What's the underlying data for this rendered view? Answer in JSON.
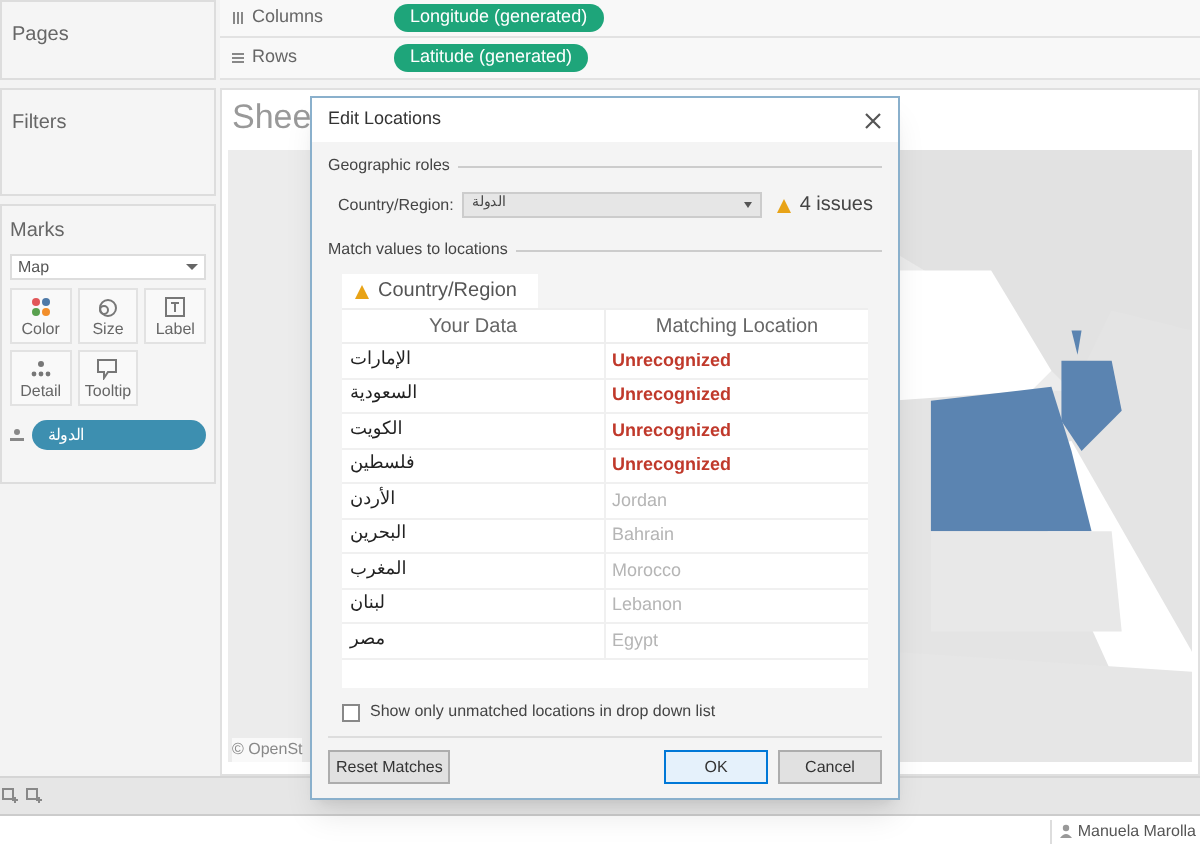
{
  "pages_label": "Pages",
  "columns_shelf": {
    "label": "Columns",
    "pill": "Longitude (generated)"
  },
  "rows_shelf": {
    "label": "Rows",
    "pill": "Latitude (generated)"
  },
  "filters_label": "Filters",
  "marks": {
    "label": "Marks",
    "type": "Map",
    "buttons": [
      {
        "label": "Color",
        "kind": "color"
      },
      {
        "label": "Size",
        "kind": "size"
      },
      {
        "label": "Label",
        "kind": "label"
      },
      {
        "label": "Detail",
        "kind": "detail"
      },
      {
        "label": "Tooltip",
        "kind": "tooltip"
      }
    ],
    "pill": "الدولة"
  },
  "sheet_title": "Shee",
  "map_credit": "© OpenSt",
  "dialog": {
    "title": "Edit Locations",
    "roles_heading": "Geographic roles",
    "role_label": "Country/Region:",
    "role_value": "الدولة",
    "issues": "4 issues",
    "match_heading": "Match values to locations",
    "tab": "Country/Region",
    "columns": [
      "Your Data",
      "Matching Location"
    ],
    "rows": [
      {
        "data": "الإمارات",
        "match": "Unrecognized",
        "recognized": false
      },
      {
        "data": "السعودية",
        "match": "Unrecognized",
        "recognized": false
      },
      {
        "data": "الكويت",
        "match": "Unrecognized",
        "recognized": false
      },
      {
        "data": "فلسطين",
        "match": "Unrecognized",
        "recognized": false
      },
      {
        "data": "الأردن",
        "match": "Jordan",
        "recognized": true
      },
      {
        "data": "البحرين",
        "match": "Bahrain",
        "recognized": true
      },
      {
        "data": "المغرب",
        "match": "Morocco",
        "recognized": true
      },
      {
        "data": "لبنان",
        "match": "Lebanon",
        "recognized": true
      },
      {
        "data": "مصر",
        "match": "Egypt",
        "recognized": true
      }
    ],
    "checkbox": {
      "label": "Show only unmatched locations in drop down list",
      "checked": false
    },
    "reset_button": "Reset Matches",
    "ok_button": "OK",
    "cancel_button": "Cancel"
  },
  "status_bar": {
    "user": "Manuela Marolla"
  }
}
